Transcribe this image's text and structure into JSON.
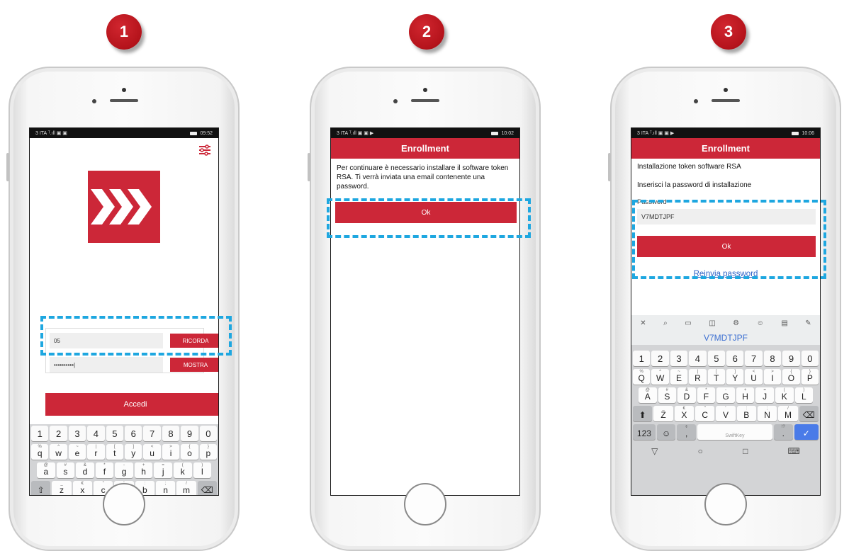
{
  "steps": [
    {
      "number": "1"
    },
    {
      "number": "2"
    },
    {
      "number": "3"
    }
  ],
  "phone1": {
    "status_left": "3 ITA ᵀ.ıll ▣ ▣",
    "status_right": "09:52",
    "username_value": "05",
    "password_value": "••••••••••|",
    "remember_label": "RICORDA",
    "show_label": "MOSTRA",
    "login_label": "Accedi",
    "settings_icon": "sliders-icon"
  },
  "phone2": {
    "status_left": "3 ITA ᵀ.ıll ▣ ▣ ▶",
    "status_right": "10:02",
    "header_title": "Enrollment",
    "message": "Per continuare è necessario installare il software token RSA. Ti verrà inviata una email contenente una password.",
    "ok_label": "Ok"
  },
  "phone3": {
    "status_left": "3 ITA ᵀ.ıll ▣ ▣ ▶",
    "status_right": "10:06",
    "header_title": "Enrollment",
    "install_text": "Installazione token software RSA",
    "prompt_text": "Inserisci la password di installazione",
    "password_label": "Password",
    "password_value": "V7MDTJPF",
    "ok_label": "Ok",
    "resend_label": "Reinvia password",
    "suggestion_word": "V7MDTJPF"
  },
  "keyboard_lower": {
    "numbers": [
      "1",
      "2",
      "3",
      "4",
      "5",
      "6",
      "7",
      "8",
      "9",
      "0"
    ],
    "row1": [
      "q",
      "w",
      "e",
      "r",
      "t",
      "y",
      "u",
      "i",
      "o",
      "p"
    ],
    "row1_sup": [
      "%",
      "^",
      "~",
      "|",
      "[",
      "]",
      "<",
      ">",
      "{",
      "}"
    ],
    "row2": [
      "a",
      "s",
      "d",
      "f",
      "g",
      "h",
      "j",
      "k",
      "l"
    ],
    "row2_sup": [
      "@",
      "#",
      "&",
      "*",
      "-",
      "+",
      "=",
      "(",
      ")"
    ],
    "row3": [
      "z",
      "x",
      "c",
      "v",
      "b",
      "n",
      "m"
    ],
    "row3_sup": [
      "_",
      "€",
      "\"",
      "'",
      ":",
      ";",
      "/"
    ],
    "key_123": "123",
    "space_label": "SwiftKey",
    "comma": ",",
    "period": "."
  },
  "keyboard_upper": {
    "row1": [
      "Q",
      "W",
      "E",
      "R",
      "T",
      "Y",
      "U",
      "I",
      "O",
      "P"
    ],
    "row2": [
      "A",
      "S",
      "D",
      "F",
      "G",
      "H",
      "J",
      "K",
      "L"
    ],
    "row3": [
      "Z",
      "X",
      "C",
      "V",
      "B",
      "N",
      "M"
    ]
  },
  "colors": {
    "brand_red": "#cc2738",
    "highlight_blue": "#1ea7e0",
    "badge_red": "#b4131b"
  }
}
